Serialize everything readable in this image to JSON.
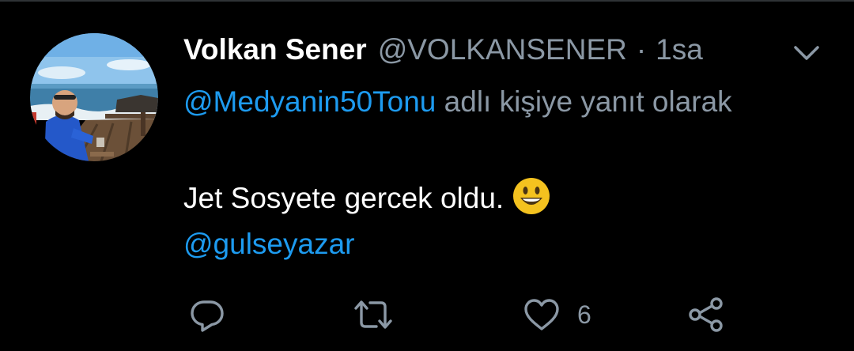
{
  "tweet": {
    "author_name": "Volkan Sener",
    "author_handle": "@VOLKANSENER",
    "separator": "·",
    "time": "1sa",
    "reply_mention": "@Medyanin50Tonu",
    "reply_suffix": "adlı kişiye yanıt olarak",
    "text": "Jet Sosyete gercek oldu.",
    "emoji": "grinning-face-emoji",
    "mention": "@gulseyazar",
    "like_count": "6"
  },
  "actions": {
    "icons": [
      "reply-icon",
      "retweet-icon",
      "like-icon",
      "share-icon"
    ]
  },
  "colors": {
    "background": "#000000",
    "text_primary": "#ffffff",
    "text_secondary": "#8b98a5",
    "link": "#1d9bf0",
    "emoji_face": "#f4c21f"
  }
}
